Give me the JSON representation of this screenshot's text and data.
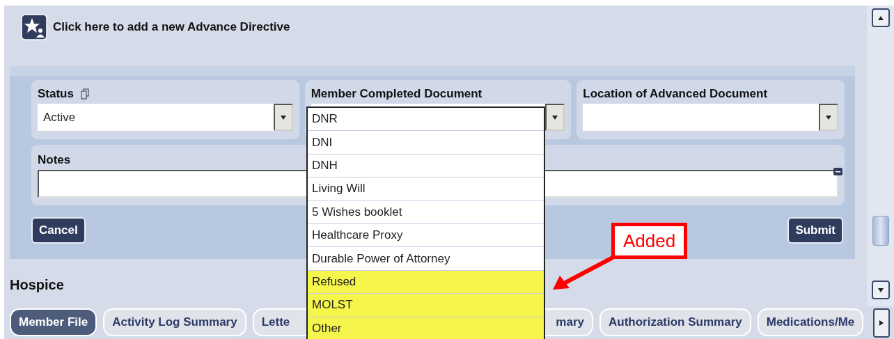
{
  "header": {
    "link": "Click here to add a new Advance Directive"
  },
  "form": {
    "status": {
      "label": "Status",
      "value": "Active"
    },
    "member_completed_document": {
      "label": "Member Completed Document",
      "expanded": true,
      "options": [
        {
          "label": "DNR",
          "highlighted": false
        },
        {
          "label": "DNI",
          "highlighted": false
        },
        {
          "label": "DNH",
          "highlighted": false
        },
        {
          "label": "Living Will",
          "highlighted": false
        },
        {
          "label": "5 Wishes booklet",
          "highlighted": false
        },
        {
          "label": "Healthcare Proxy",
          "highlighted": false
        },
        {
          "label": "Durable Power of Attorney",
          "highlighted": false
        },
        {
          "label": "Refused",
          "highlighted": true
        },
        {
          "label": "MOLST",
          "highlighted": true
        },
        {
          "label": "Other",
          "highlighted": true
        }
      ]
    },
    "location": {
      "label": "Location of Advanced Document"
    },
    "notes": {
      "label": "Notes"
    },
    "buttons": [
      {
        "label": "Cancel"
      },
      {
        "label": "Submit"
      }
    ]
  },
  "section": {
    "title": "Hospice"
  },
  "tabs": [
    {
      "label": "Member File",
      "selected": true
    },
    {
      "label": "Activity Log Summary",
      "selected": false
    },
    {
      "label_start": "Lette",
      "label_end": "mary",
      "selected": false
    },
    {
      "label": "Authorization Summary",
      "selected": false
    },
    {
      "label": "Medications/Me",
      "selected": false
    }
  ],
  "annotation": {
    "text": "Added"
  }
}
